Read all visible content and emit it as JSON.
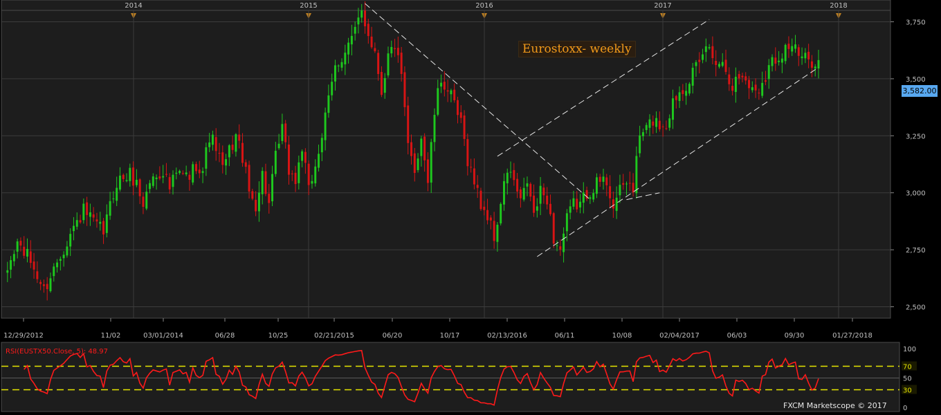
{
  "chart_data": {
    "type": "candlestick",
    "title": "Eurostoxx- weekly",
    "instrument": "EUSTX50",
    "last_price_label": "3,582.00",
    "watermark": "FXCM Marketscope © 2017",
    "ylim": [
      2450,
      3800
    ],
    "y_ticks": [
      2500,
      2750,
      3000,
      3250,
      3500,
      3750
    ],
    "y_tick_labels": [
      "2,500",
      "2,750",
      "3,000",
      "3,250",
      "3,500",
      "3,750"
    ],
    "x_tick_labels": [
      "12/29/2012",
      "11/02",
      "03/01/2014",
      "06/28",
      "10/25",
      "02/21/2015",
      "06/20",
      "10/17",
      "02/13/2016",
      "06/11",
      "10/08",
      "02/04/2017",
      "06/03",
      "09/30",
      "01/27/2018"
    ],
    "year_labels": [
      "2014",
      "2015",
      "2016",
      "2017",
      "2018"
    ],
    "colors": {
      "up": "#1ec81e",
      "down": "#d81414",
      "grid": "#3c3c3c",
      "panel": "#1d1d1d",
      "axis_text": "#c0c0c0",
      "trend": "#e6e6e6",
      "rsi": "#ff1a1a",
      "rsi_band": "#e6e600",
      "year_marker": "#c08020"
    },
    "close_path": [
      [
        0,
        2620
      ],
      [
        4,
        2780
      ],
      [
        8,
        2700
      ],
      [
        12,
        2570
      ],
      [
        16,
        2700
      ],
      [
        20,
        2820
      ],
      [
        24,
        2920
      ],
      [
        28,
        2850
      ],
      [
        30,
        2830
      ],
      [
        34,
        3050
      ],
      [
        38,
        3080
      ],
      [
        40,
        3040
      ],
      [
        42,
        2950
      ],
      [
        44,
        3050
      ],
      [
        48,
        3100
      ],
      [
        50,
        3020
      ],
      [
        52,
        3080
      ],
      [
        56,
        3070
      ],
      [
        58,
        3130
      ],
      [
        60,
        3100
      ],
      [
        62,
        3250
      ],
      [
        64,
        3200
      ],
      [
        66,
        3100
      ],
      [
        68,
        3180
      ],
      [
        70,
        3250
      ],
      [
        72,
        3160
      ],
      [
        74,
        3000
      ],
      [
        76,
        2950
      ],
      [
        78,
        3080
      ],
      [
        80,
        2950
      ],
      [
        82,
        3150
      ],
      [
        84,
        3280
      ],
      [
        86,
        3100
      ],
      [
        88,
        3050
      ],
      [
        90,
        3200
      ],
      [
        92,
        3000
      ],
      [
        96,
        3250
      ],
      [
        100,
        3550
      ],
      [
        104,
        3650
      ],
      [
        106,
        3700
      ],
      [
        108,
        3800
      ],
      [
        110,
        3700
      ],
      [
        112,
        3620
      ],
      [
        114,
        3450
      ],
      [
        116,
        3600
      ],
      [
        118,
        3650
      ],
      [
        120,
        3500
      ],
      [
        122,
        3200
      ],
      [
        124,
        3100
      ],
      [
        126,
        3250
      ],
      [
        128,
        3050
      ],
      [
        130,
        3350
      ],
      [
        132,
        3500
      ],
      [
        134,
        3450
      ],
      [
        136,
        3380
      ],
      [
        138,
        3300
      ],
      [
        140,
        3150
      ],
      [
        142,
        3050
      ],
      [
        144,
        2950
      ],
      [
        146,
        2900
      ],
      [
        148,
        2800
      ],
      [
        150,
        2950
      ],
      [
        152,
        3100
      ],
      [
        154,
        3050
      ],
      [
        156,
        2950
      ],
      [
        158,
        3050
      ],
      [
        160,
        2900
      ],
      [
        162,
        3000
      ],
      [
        164,
        2980
      ],
      [
        166,
        2800
      ],
      [
        168,
        2750
      ],
      [
        170,
        2880
      ],
      [
        172,
        2950
      ],
      [
        174,
        2950
      ],
      [
        176,
        3000
      ],
      [
        178,
        3030
      ],
      [
        180,
        3050
      ],
      [
        182,
        3050
      ],
      [
        184,
        2950
      ],
      [
        186,
        3000
      ],
      [
        188,
        3050
      ],
      [
        190,
        3020
      ],
      [
        192,
        3250
      ],
      [
        194,
        3280
      ],
      [
        196,
        3320
      ],
      [
        198,
        3300
      ],
      [
        200,
        3300
      ],
      [
        202,
        3400
      ],
      [
        204,
        3450
      ],
      [
        206,
        3480
      ],
      [
        208,
        3530
      ],
      [
        210,
        3550
      ],
      [
        212,
        3650
      ],
      [
        214,
        3600
      ],
      [
        216,
        3580
      ],
      [
        218,
        3550
      ],
      [
        220,
        3470
      ],
      [
        222,
        3510
      ],
      [
        224,
        3500
      ],
      [
        226,
        3450
      ],
      [
        228,
        3460
      ],
      [
        230,
        3520
      ],
      [
        232,
        3580
      ],
      [
        234,
        3600
      ],
      [
        236,
        3640
      ],
      [
        238,
        3650
      ],
      [
        240,
        3600
      ],
      [
        242,
        3582
      ]
    ],
    "trend_lines": [
      {
        "name": "downtrend",
        "from": [
          109,
          3830
        ],
        "to": [
          177,
          2970
        ]
      },
      {
        "name": "channel-upper",
        "from": [
          149,
          3160
        ],
        "to": [
          213,
          3760
        ]
      },
      {
        "name": "channel-lower",
        "from": [
          161,
          2720
        ],
        "to": [
          246,
          3550
        ]
      },
      {
        "name": "right-lower-channel",
        "from": [
          188,
          2970
        ],
        "to": [
          198,
          3000
        ]
      }
    ],
    "rsi": {
      "label": "RSI(EUSTX50.Close, 5): 48.97",
      "period": 5,
      "last_value": 48.97,
      "levels": [
        70,
        50,
        30
      ],
      "scale_labels": [
        "100",
        "70",
        "50",
        "30",
        "0"
      ]
    }
  }
}
